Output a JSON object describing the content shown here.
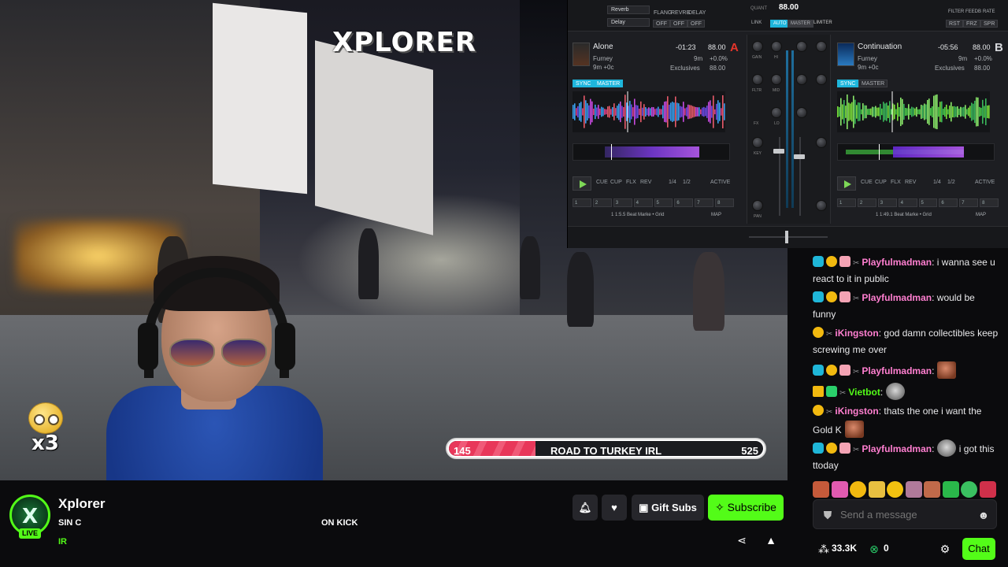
{
  "overlay": {
    "logo": "XPLORER",
    "combo_multiplier": "x3",
    "goal": {
      "left_value": "145",
      "title": "ROAD TO TURKEY IRL",
      "right_value": "525",
      "progress": 0.276
    }
  },
  "dj": {
    "fx1": "Reverb",
    "fx2": "Delay",
    "fx_buttons": [
      "FLANG",
      "REVRB",
      "DELAY"
    ],
    "off_labels": [
      "OFF",
      "OFF",
      "OFF"
    ],
    "quant_label": "QUANT",
    "bpm_master": "88.00",
    "mix_buttons": [
      "LINK",
      "AUTO",
      "MASTER",
      "LIMITER"
    ],
    "right_fx_buttons": [
      "FILTER",
      "FEEDB",
      "RATE"
    ],
    "right_top_buttons": [
      "RST",
      "FRZ",
      "SPR"
    ],
    "deck_a": {
      "title": "Alone",
      "artist": "Furney",
      "key": "9m +0c",
      "album": "Exclusives",
      "time": "-01:23",
      "bpm": "88.00",
      "key2": "9m",
      "pitch": "+0.0%",
      "bpm2": "88.00",
      "letter": "A",
      "sync": "SYNC",
      "master": "MASTER",
      "controls": [
        "CUE",
        "CUP",
        "FLX",
        "REV"
      ],
      "loop_labels": [
        "1/4",
        "1/2"
      ],
      "active": "ACTIVE",
      "pads": [
        "1",
        "2",
        "3",
        "4",
        "5",
        "6",
        "7",
        "8"
      ],
      "beat_info": "1  1:5.5  Beat Marke • Grid",
      "map": "MAP",
      "move": "MOVE"
    },
    "deck_b": {
      "title": "Continuation",
      "artist": "Furney",
      "key": "9m +0c",
      "album": "Exclusives",
      "time": "-05:56",
      "bpm": "88.00",
      "key2": "9m",
      "pitch": "+0.0%",
      "bpm2": "88.00",
      "letter": "B",
      "sync": "SYNC",
      "master": "MASTER",
      "controls": [
        "CUE",
        "CUP",
        "FLX",
        "REV"
      ],
      "loop_labels": [
        "1/4",
        "1/2"
      ],
      "active": "ACTIVE",
      "pads": [
        "1",
        "2",
        "3",
        "4",
        "5",
        "6",
        "7",
        "8"
      ],
      "beat_info": "1  1:49.1  Beat Marke • Grid",
      "map": "MAP",
      "move": "MOVE"
    },
    "mixer_labels": {
      "gain": "GAIN",
      "hi": "HI",
      "mid": "MID",
      "lo": "LO",
      "fx": "FX",
      "fltr": "FLTR",
      "key": "KEY",
      "pan": "PAN"
    },
    "colors": {
      "deck_a": "#e6352b",
      "deck_b": "#2f8be6",
      "accent": "#1eb6dc",
      "play": "#7ed957"
    }
  },
  "chat": {
    "messages": [
      {
        "user": "Playfulmadman",
        "text": " i wanna see u react to it in public",
        "color": "#ff7fd0",
        "badges": [
          "sub",
          "gold",
          "pink"
        ]
      },
      {
        "user": "Playfulmadman",
        "text": " would be funny",
        "color": "#ff7fd0",
        "badges": [
          "sub",
          "gold",
          "pink"
        ]
      },
      {
        "user": "iKingston",
        "text": " god damn collectibles keep screwing me over",
        "color": "#ff7fd0",
        "badges": [
          "gold"
        ]
      },
      {
        "user": "Playfulmadman",
        "text": "",
        "color": "#ff7fd0",
        "badges": [
          "sub",
          "gold",
          "pink"
        ]
      },
      {
        "user": "Vietbot",
        "text": "",
        "color": "#53fc18",
        "badges": [
          "crown",
          "game"
        ]
      },
      {
        "user": "iKingston",
        "text": " thats the one i want the Gold K",
        "color": "#ff7fd0",
        "badges": [
          "gold"
        ]
      },
      {
        "user": "Playfulmadman",
        "text": " i got this ttoday",
        "color": "#ff7fd0",
        "badges": [
          "sub",
          "gold",
          "pink"
        ]
      }
    ],
    "placeholder": "Send a message",
    "viewers": "33.3K",
    "points": "0",
    "chat_button": "Chat"
  },
  "stream": {
    "channel": "Xplorer",
    "title_left": "SIN C",
    "title_right": "ON KICK",
    "category": "IR",
    "live_label": "LIVE",
    "gift_subs": "Gift Subs",
    "subscribe": "Subscribe",
    "accent": "#53fc18"
  }
}
